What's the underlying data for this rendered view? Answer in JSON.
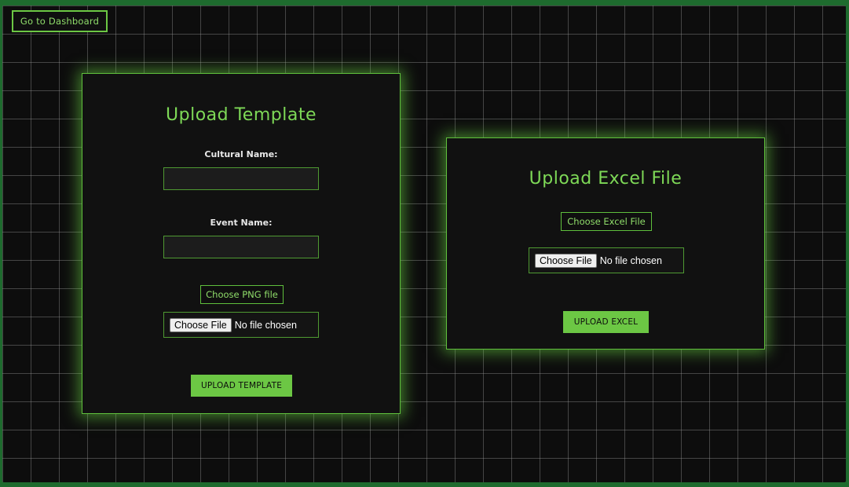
{
  "nav": {
    "dashboard_label": "Go to Dashboard"
  },
  "template_card": {
    "title": "Upload Template",
    "cultural_label": "Cultural Name:",
    "cultural_value": "",
    "event_label": "Event Name:",
    "event_value": "",
    "choose_png_label": "Choose PNG file",
    "file_button_label": "Choose File",
    "file_status": "No file chosen",
    "submit_label": "UPLOAD TEMPLATE"
  },
  "excel_card": {
    "title": "Upload Excel File",
    "choose_excel_label": "Choose Excel File",
    "file_button_label": "Choose File",
    "file_status": "No file chosen",
    "submit_label": "UPLOAD EXCEL"
  },
  "colors": {
    "accent": "#6cc744",
    "title_green": "#7ed957",
    "background": "#0d0d0d",
    "card": "#111111"
  }
}
